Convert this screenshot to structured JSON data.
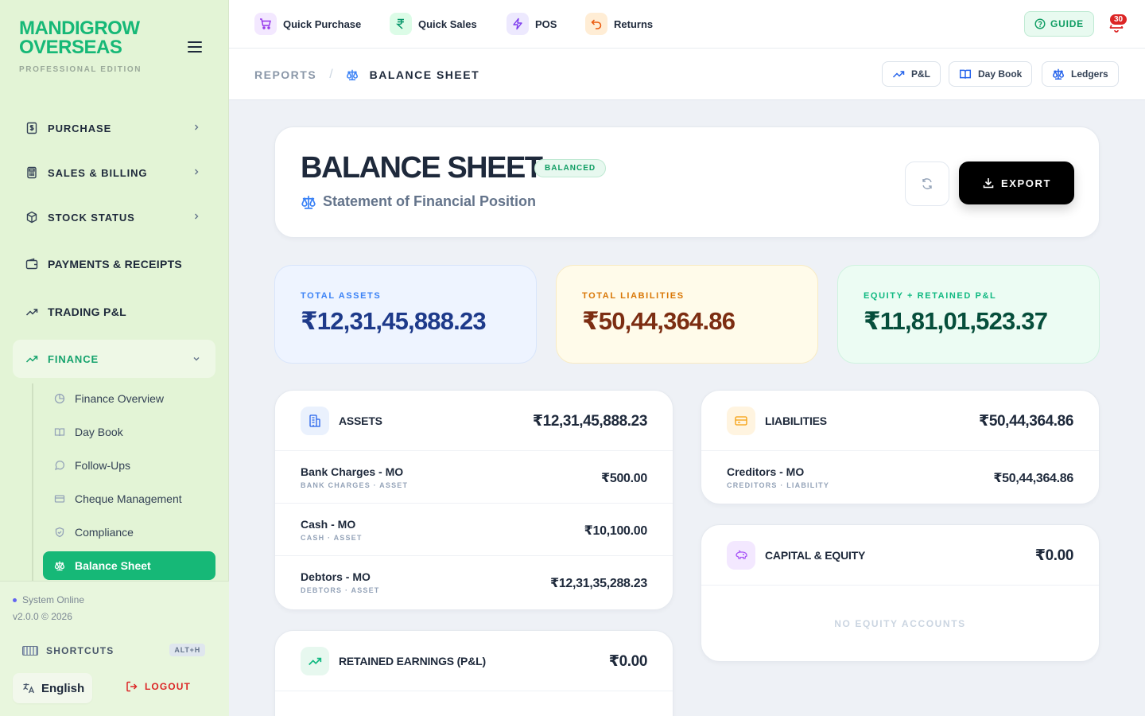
{
  "brand": {
    "line1": "MANDIGROW",
    "line2": "OVERSEAS",
    "edition": "PROFESSIONAL EDITION"
  },
  "sidebar": {
    "items": [
      {
        "label": "PURCHASE",
        "icon": "receipt-icon"
      },
      {
        "label": "SALES & BILLING",
        "icon": "calculator-icon"
      },
      {
        "label": "STOCK STATUS",
        "icon": "box-icon"
      },
      {
        "label": "PAYMENTS & RECEIPTS",
        "icon": "wallet-icon"
      },
      {
        "label": "TRADING P&L",
        "icon": "trending-up-icon"
      },
      {
        "label": "FINANCE",
        "icon": "trending-up-icon"
      }
    ],
    "finance_sub": [
      {
        "label": "Finance Overview",
        "icon": "pie-chart-icon"
      },
      {
        "label": "Day Book",
        "icon": "book-open-icon"
      },
      {
        "label": "Follow-Ups",
        "icon": "message-icon"
      },
      {
        "label": "Cheque Management",
        "icon": "card-icon"
      },
      {
        "label": "Compliance",
        "icon": "shield-icon"
      },
      {
        "label": "Balance Sheet",
        "icon": "scale-icon"
      }
    ],
    "footer": {
      "status": "System Online",
      "version": "v2.0.0 © 2026",
      "shortcuts_label": "SHORTCUTS",
      "shortcuts_key": "ALT+H",
      "language": "English",
      "logout": "LOGOUT"
    }
  },
  "topbar": {
    "quick": [
      {
        "label": "Quick Purchase",
        "icon": "cart-icon",
        "color": "#9333ea",
        "bg": "#f3e8ff"
      },
      {
        "label": "Quick Sales",
        "icon": "rupee-icon",
        "color": "#059669",
        "bg": "#dcfce7"
      },
      {
        "label": "POS",
        "icon": "zap-icon",
        "color": "#7c3aed",
        "bg": "#ede9fe"
      },
      {
        "label": "Returns",
        "icon": "undo-icon",
        "color": "#ea580c",
        "bg": "#ffedd5"
      }
    ],
    "guide": "GUIDE",
    "notifications": "30"
  },
  "breadcrumb": {
    "parent": "REPORTS",
    "separator": "/",
    "current": "BALANCE SHEET"
  },
  "quick_links": [
    {
      "label": "P&L",
      "icon": "trending-up-icon"
    },
    {
      "label": "Day Book",
      "icon": "book-open-icon"
    },
    {
      "label": "Ledgers",
      "icon": "scale-icon"
    }
  ],
  "header": {
    "title": "BALANCE SHEET",
    "status": "BALANCED",
    "subtitle": "Statement of Financial Position",
    "export": "EXPORT"
  },
  "stats": [
    {
      "label": "TOTAL ASSETS",
      "value": "₹12,31,45,888.23"
    },
    {
      "label": "TOTAL LIABILITIES",
      "value": "₹50,44,364.86"
    },
    {
      "label": "EQUITY + RETAINED P&L",
      "value": "₹11,81,01,523.37"
    }
  ],
  "assets": {
    "title": "ASSETS",
    "total": "₹12,31,45,888.23",
    "rows": [
      {
        "name": "Bank Charges - MO",
        "sub": "BANK CHARGES · ASSET",
        "value": "₹500.00"
      },
      {
        "name": "Cash - MO",
        "sub": "CASH · ASSET",
        "value": "₹10,100.00"
      },
      {
        "name": "Debtors - MO",
        "sub": "DEBTORS · ASSET",
        "value": "₹12,31,35,288.23"
      }
    ]
  },
  "liabilities": {
    "title": "LIABILITIES",
    "total": "₹50,44,364.86",
    "rows": [
      {
        "name": "Creditors - MO",
        "sub": "CREDITORS · LIABILITY",
        "value": "₹50,44,364.86"
      }
    ]
  },
  "capital": {
    "title": "CAPITAL & EQUITY",
    "total": "₹0.00",
    "empty": "NO EQUITY ACCOUNTS"
  },
  "retained": {
    "title": "RETAINED EARNINGS (P&L)",
    "total": "₹0.00"
  },
  "colors": {
    "brand_green": "#16b877",
    "accent_blue": "#3b82f6",
    "danger": "#dc2626"
  }
}
